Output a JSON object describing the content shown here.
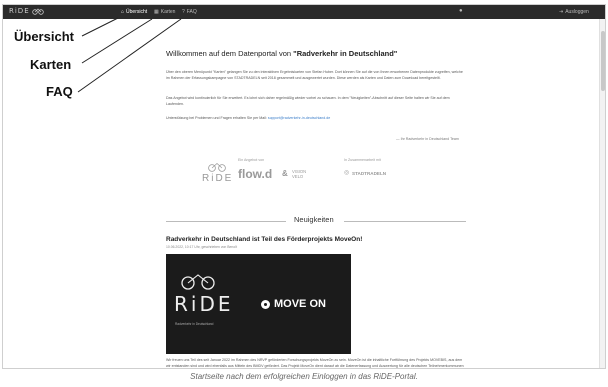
{
  "navbar": {
    "brand": "RiDE",
    "items": [
      {
        "label": "Übersicht",
        "icon": "home-icon",
        "active": true
      },
      {
        "label": "Karten",
        "icon": "map-icon",
        "active": false
      },
      {
        "label": "FAQ",
        "icon": "question-icon",
        "active": false
      }
    ],
    "user_icon": "user-icon",
    "logout": "Ausloggen"
  },
  "annotations": [
    "Übersicht",
    "Karten",
    "FAQ"
  ],
  "welcome": {
    "prefix": "Willkommen auf dem Datenportal von ",
    "name": "\"Radverkehr in Deutschland\"",
    "para1": "Über den oberen Menüpunkt \"Karten\" gelangen Sie zu den interaktiven Ergebniskarten von Stefan Huber. Dort können Sie auf die von Ihnen erworbenen Datenprodukte zugreifen, welche im Rahmen der Erfassungskampagne von STADTRADELN seit 2018 gesammelt und ausgewertet wurden. Diese werden als Karten und Daten zum Download bereitgestellt.",
    "para2": "Das Angebot wird kontinuierlich für Sie erweitert. Es lohnt sich daher regelmäßig wieder vorbei zu schauen. In dem \"Neuigkeiten\"-Abschnitt auf dieser Seite halten wir Sie auf dem Laufenden.",
    "para3_prefix": "Unterstützung bei Problemen und Fragen erhalten Sie per Mail: ",
    "para3_link": "support@radverkehr-in-deutschland.de",
    "signature": "— Ihr Radverkehr in Deutschland Team"
  },
  "partners": {
    "offer_label": "Ein Angebot von",
    "cooperation_label": "In Zusammenarbeit mit",
    "ride": "RiDE",
    "flow": "flow.d",
    "vision": "VISION VELO",
    "stadtradeln": "STADTRADELN"
  },
  "news": {
    "heading": "Neuigkeiten",
    "article_title": "Radverkehr in Deutschland ist Teil des Förderprojekts MoveOn!",
    "article_meta": "10.06.2022, 10:17 Uhr, geschrieben von Benoît",
    "hero_ride": "RiDE",
    "hero_sub": "Radverkehr in Deutschland",
    "hero_moveon": "MOVE ON",
    "article_text": "Wir freuen uns Teil des seit Januar 2022 im Rahmen des NRVP geförderten Forschungsprojekts MoveOn zu sein. MoveOn ist die inhaltliche Fortführung des Projekts MOVEBIS, aus dem wir entstanden sind und wird ebenfalls aus Mitteln des BMDV gefördert. Das Projekt MoveOn dient darauf ab die Datenerfassung und Auswertung für alle deutschen Teilnehmerkommunen der Kampagne STADTRADELN sicherzustellen und weiterzuentwickeln. RiDE-"
  },
  "caption": "Startseite nach dem erfolgreichen Einloggen in das RiDE-Portal."
}
